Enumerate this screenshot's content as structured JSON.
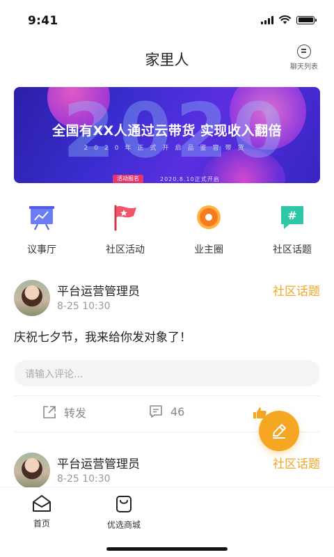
{
  "status_bar": {
    "time": "9:41"
  },
  "header": {
    "title": "家里人",
    "chat_list_label": "聊天列表"
  },
  "banner": {
    "big_text": "2020",
    "headline": "全国有XX人通过云带货 实现收入翻倍",
    "subline": "2020年正式开启品鉴官带货",
    "tag": "活动报名",
    "date": "2020.8.10正式开启"
  },
  "categories": [
    {
      "label": "议事厅",
      "icon": "meeting-board-icon",
      "color": "#6b7cf5"
    },
    {
      "label": "社区活动",
      "icon": "flag-icon",
      "color": "#f0556a"
    },
    {
      "label": "业主圈",
      "icon": "circle-icon",
      "color": "#f77b1e"
    },
    {
      "label": "社区话题",
      "icon": "hashtag-icon",
      "color": "#2ec7a7"
    }
  ],
  "posts": [
    {
      "author": "平台运营管理员",
      "time": "8-25 10:30",
      "topic": "社区话题",
      "content": "庆祝七夕节，我来给你发对象了！",
      "comment_placeholder": "请输入评论...",
      "share_label": "转发",
      "comment_count": "46"
    },
    {
      "author": "平台运营管理员",
      "time": "8-25 10:30",
      "topic": "社区话题"
    }
  ],
  "tabbar": {
    "items": [
      {
        "label": "首页",
        "icon": "home-icon"
      },
      {
        "label": "优选商城",
        "icon": "shopping-bag-icon"
      }
    ]
  },
  "colors": {
    "accent": "#f5a623",
    "text": "#222222",
    "muted": "#999999"
  }
}
